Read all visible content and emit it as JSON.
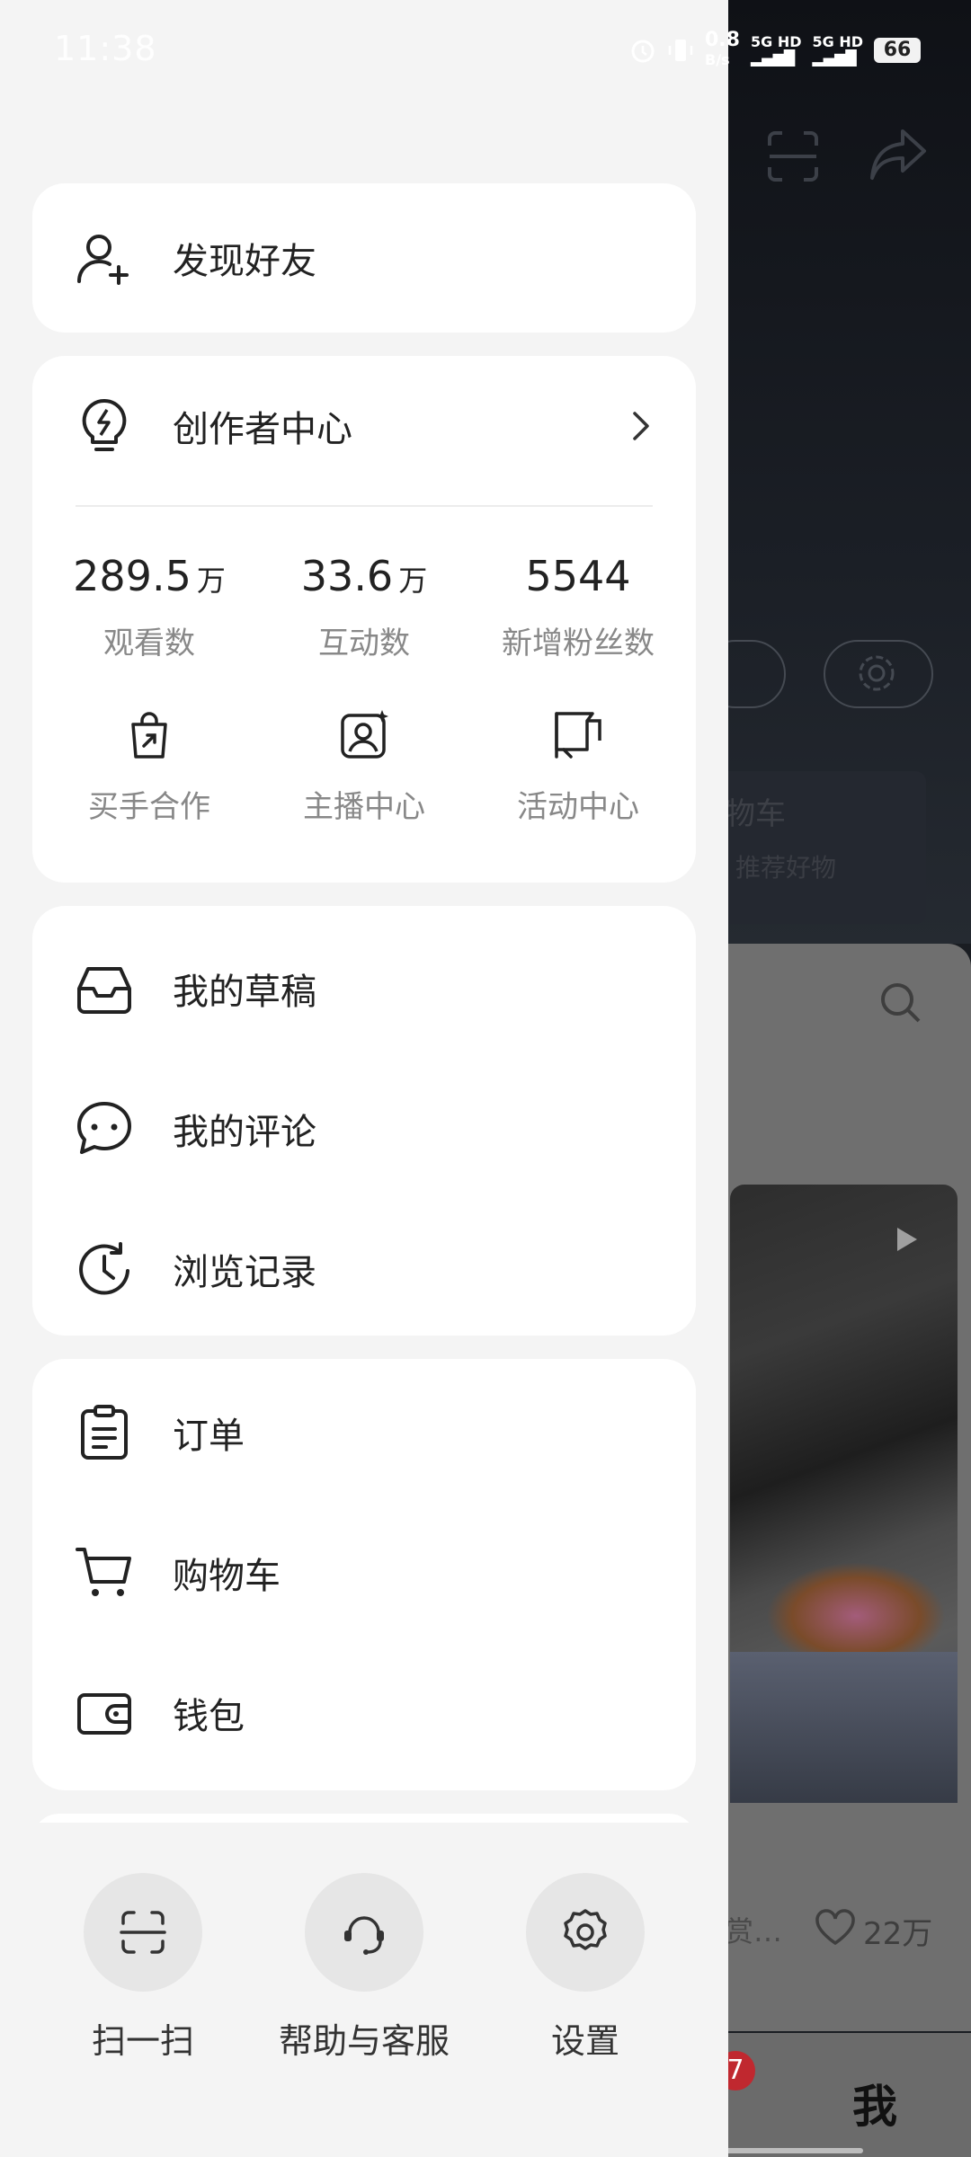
{
  "status_bar": {
    "time": "11:38",
    "net_speed_value": "0.8",
    "net_speed_unit": "B/s",
    "sim1": "5G HD",
    "sim2": "5G HD",
    "battery": "66"
  },
  "drawer": {
    "find_friends": "发现好友",
    "creator_center": {
      "title": "创作者中心",
      "stats": [
        {
          "value": "289.5",
          "unit": "万",
          "label": "观看数"
        },
        {
          "value": "33.6",
          "unit": "万",
          "label": "互动数"
        },
        {
          "value": "5544",
          "unit": "",
          "label": "新增粉丝数"
        }
      ],
      "tools": [
        {
          "label": "买手合作",
          "icon": "shopping-bag-icon"
        },
        {
          "label": "主播中心",
          "icon": "streamer-icon"
        },
        {
          "label": "活动中心",
          "icon": "flag-icon"
        }
      ]
    },
    "content_items": [
      {
        "label": "我的草稿",
        "icon": "inbox-icon"
      },
      {
        "label": "我的评论",
        "icon": "comment-icon"
      },
      {
        "label": "浏览记录",
        "icon": "history-icon"
      }
    ],
    "commerce_items": [
      {
        "label": "订单",
        "icon": "clipboard-icon"
      },
      {
        "label": "购物车",
        "icon": "cart-icon"
      },
      {
        "label": "钱包",
        "icon": "wallet-icon"
      }
    ],
    "bottom_actions": [
      {
        "label": "扫一扫",
        "icon": "scan-icon"
      },
      {
        "label": "帮助与客服",
        "icon": "headset-icon"
      },
      {
        "label": "设置",
        "icon": "gear-icon"
      }
    ]
  },
  "background": {
    "cart_text": "物车",
    "recommend_text": "推荐好物",
    "like_count": "22万",
    "post_text": "赏…",
    "badge": "7",
    "me_tab": "我"
  }
}
